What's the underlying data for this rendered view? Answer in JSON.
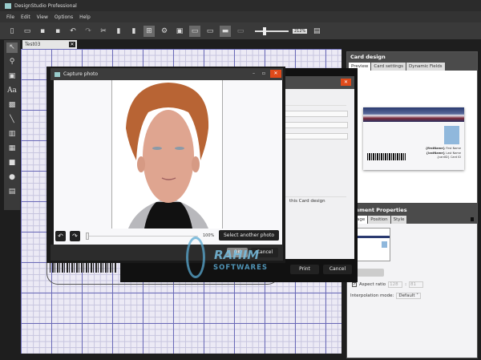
{
  "app": {
    "title": "DesignStudio Professional"
  },
  "menu": [
    "File",
    "Edit",
    "View",
    "Options",
    "Help"
  ],
  "toolbar": {
    "zoom": "212%"
  },
  "document_tab": {
    "label": "Test03"
  },
  "card_design": {
    "title": "Card design",
    "tabs": [
      "Preview",
      "Card settings",
      "Dynamic Fields"
    ],
    "fields": [
      {
        "key": "{firstName}",
        "value": "First Name"
      },
      {
        "key": "{lastName}",
        "value": "Last Name"
      },
      {
        "key": "{cardID}",
        "value": "Card ID"
      }
    ]
  },
  "element_properties": {
    "title": "Element Properties",
    "tabs": [
      "Image",
      "Position",
      "Style"
    ],
    "aspect_ratio_label": "Aspect ratio",
    "aspect_w": "128",
    "aspect_h": "81",
    "interp_label": "Interpolation mode:",
    "interp_value": "Default"
  },
  "print_dialog": {
    "text": "this Card design",
    "print": "Print",
    "cancel": "Cancel"
  },
  "capture": {
    "title": "Capture photo",
    "zoom": "100%",
    "select_another": "Select another photo",
    "ok": "OK",
    "cancel": "Cancel"
  },
  "watermark": {
    "line1": "RAHIM",
    "line2": "SOFTWARES"
  }
}
